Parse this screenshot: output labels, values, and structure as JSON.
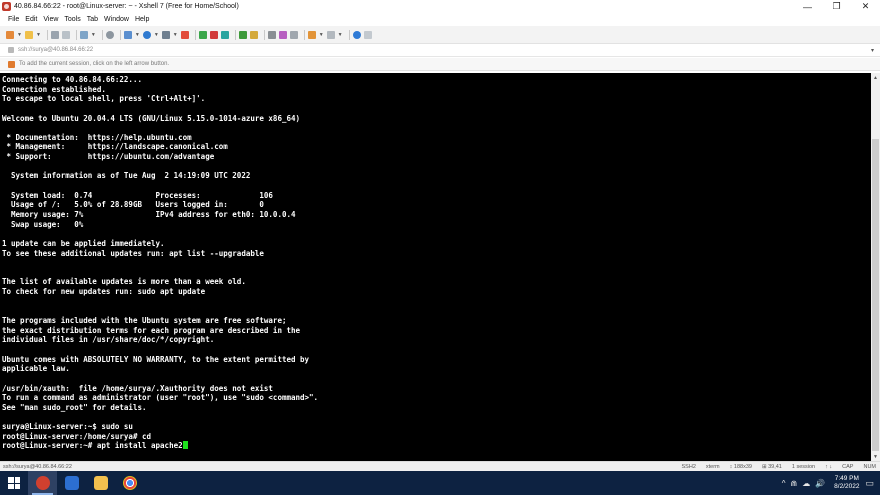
{
  "window": {
    "title": "40.86.84.66:22 - root@Linux-server: ~ - Xshell 7 (Free for Home/School)",
    "minimize_glyph": "—",
    "maximize_glyph": "❐",
    "close_glyph": "✕"
  },
  "menu": [
    "File",
    "Edit",
    "View",
    "Tools",
    "Tab",
    "Window",
    "Help"
  ],
  "address": {
    "text": "ssh://surya@40.86.84.66:22",
    "dropdown_glyph": "▾"
  },
  "session_hint": "To add the current session, click on the left arrow button.",
  "terminal": {
    "lines": [
      "Connecting to 40.86.84.66:22...",
      "Connection established.",
      "To escape to local shell, press 'Ctrl+Alt+]'.",
      "",
      "Welcome to Ubuntu 20.04.4 LTS (GNU/Linux 5.15.0-1014-azure x86_64)",
      "",
      " * Documentation:  https://help.ubuntu.com",
      " * Management:     https://landscape.canonical.com",
      " * Support:        https://ubuntu.com/advantage",
      "",
      "  System information as of Tue Aug  2 14:19:09 UTC 2022",
      "",
      "  System load:  0.74              Processes:             106",
      "  Usage of /:   5.0% of 28.89GB   Users logged in:       0",
      "  Memory usage: 7%                IPv4 address for eth0: 10.0.0.4",
      "  Swap usage:   0%",
      "",
      "1 update can be applied immediately.",
      "To see these additional updates run: apt list --upgradable",
      "",
      "",
      "The list of available updates is more than a week old.",
      "To check for new updates run: sudo apt update",
      "",
      "",
      "The programs included with the Ubuntu system are free software;",
      "the exact distribution terms for each program are described in the",
      "individual files in /usr/share/doc/*/copyright.",
      "",
      "Ubuntu comes with ABSOLUTELY NO WARRANTY, to the extent permitted by",
      "applicable law.",
      "",
      "/usr/bin/xauth:  file /home/surya/.Xauthority does not exist",
      "To run a command as administrator (user \"root\"), use \"sudo <command>\".",
      "See \"man sudo_root\" for details.",
      "",
      "surya@Linux-server:~$ sudo su",
      "root@Linux-server:/home/surya# cd"
    ],
    "prompt_line": "root@Linux-server:~# apt install apache2",
    "cursor_color": "#1de01d"
  },
  "statusbar": {
    "left": "ssh://surya@40.86.84.66:22",
    "protocol": "SSH2",
    "term": "xterm",
    "size": "↕ 188x39",
    "position": "⊞ 39,41",
    "sessions": "1 session",
    "arrows": "↑ ↓",
    "cap": "CAP",
    "num": "NUM"
  },
  "taskbar": {
    "time": "7:49 PM",
    "date": "8/2/2022",
    "tray_glyphs": [
      "^",
      "⋒",
      "☁",
      "🔊"
    ],
    "notification_glyph": "▭"
  },
  "colors": {
    "terminal_bg": "#000000",
    "terminal_fg": "#ffffff",
    "taskbar_bg": "#0d2241",
    "app_accent": "#c0392b"
  }
}
